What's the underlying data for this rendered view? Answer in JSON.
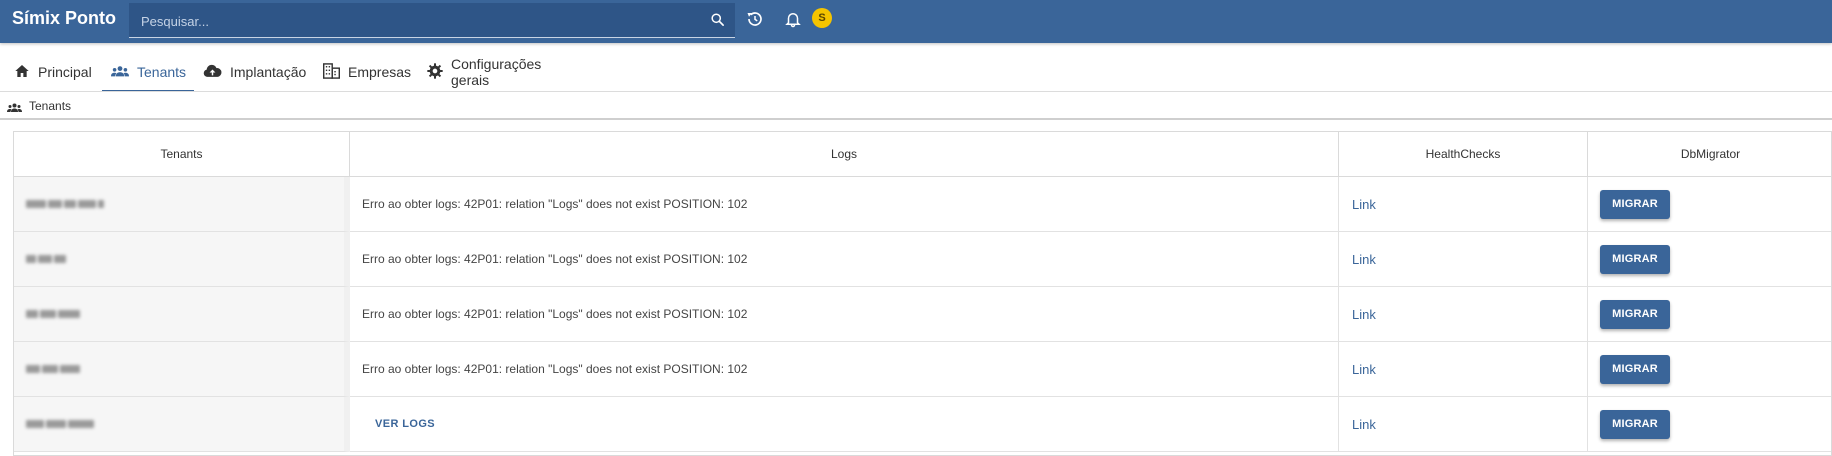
{
  "app": {
    "title": "Símix Ponto"
  },
  "search": {
    "placeholder": "Pesquisar..."
  },
  "user": {
    "initial": "S",
    "avatar_color": "#f5c400"
  },
  "colors": {
    "primary": "#3a6599",
    "topbar": "#3a6599"
  },
  "tabs": [
    {
      "label": "Principal",
      "icon": "home-icon",
      "active": false
    },
    {
      "label": "Tenants",
      "icon": "people-icon",
      "active": true
    },
    {
      "label": "Implantação",
      "icon": "cloud-upload-icon",
      "active": false
    },
    {
      "label": "Empresas",
      "icon": "building-icon",
      "active": false
    },
    {
      "label": "Configurações gerais",
      "icon": "gear-icon",
      "active": false
    }
  ],
  "breadcrumb": {
    "label": "Tenants",
    "icon": "people-icon"
  },
  "table": {
    "headers": [
      "Tenants",
      "Logs",
      "HealthChecks",
      "DbMigrator"
    ],
    "rows": [
      {
        "log": "Erro ao obter logs: 42P01: relation \"Logs\" does not exist POSITION: 102",
        "health": "Link",
        "action": "MIGRAR"
      },
      {
        "log": "Erro ao obter logs: 42P01: relation \"Logs\" does not exist POSITION: 102",
        "health": "Link",
        "action": "MIGRAR"
      },
      {
        "log": "Erro ao obter logs: 42P01: relation \"Logs\" does not exist POSITION: 102",
        "health": "Link",
        "action": "MIGRAR"
      },
      {
        "log": "Erro ao obter logs: 42P01: relation \"Logs\" does not exist POSITION: 102",
        "health": "Link",
        "action": "MIGRAR"
      },
      {
        "log_button": "VER LOGS",
        "health": "Link",
        "action": "MIGRAR"
      }
    ]
  }
}
